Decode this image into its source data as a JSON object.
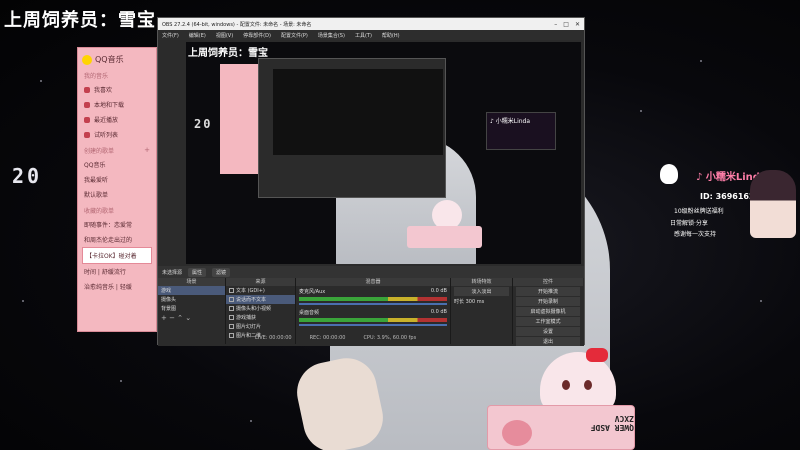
{
  "caption": "上周饲养员：雪宝",
  "big_number": "20",
  "qq_music": {
    "app_name": "QQ音乐",
    "sections": [
      {
        "title": "我的音乐",
        "items": [
          "我喜欢",
          "本地和下载",
          "最近播放",
          "试听列表"
        ]
      },
      {
        "title": "创建的歌单",
        "items": [
          "QQ音乐",
          "我最爱听",
          "默认歌单"
        ]
      },
      {
        "title": "收藏的歌单",
        "items": [
          "即随事件：恋爱常",
          "和周杰伦走出过的",
          "【卡拉OK】碰对着",
          "时间 | 舒缓流行",
          "治愈纯音乐 | 轻缓"
        ]
      }
    ]
  },
  "obs": {
    "title": "OBS 27.2.4 (64-bit, windows) - 配置文件: 未命名 - 场景: 未命名",
    "menu": [
      "文件(F)",
      "编辑(E)",
      "视图(V)",
      "停靠部件(D)",
      "配置文件(P)",
      "场景集合(S)",
      "工具(T)",
      "帮助(H)"
    ],
    "window_buttons": [
      "–",
      "□",
      "✕"
    ],
    "scene_bar": {
      "label": "未选择源",
      "properties": "属性",
      "filters": "滤镜"
    },
    "scenes": {
      "header": "场景",
      "items": [
        "游戏",
        "摄像头",
        "背景图"
      ]
    },
    "sources": {
      "header": "来源",
      "items": [
        "文本 (GDI+)",
        "说话而不文本",
        "摄像头和小视频",
        "游戏捕获",
        "图片幻灯片",
        "图片和二维"
      ]
    },
    "mixer": {
      "header": "混音器",
      "channels": [
        {
          "name": "麦克风/Aux",
          "db": "0.0 dB"
        },
        {
          "name": "桌面音频",
          "db": "0.0 dB"
        }
      ]
    },
    "transitions": {
      "header": "转场特效",
      "type": "淡入淡出",
      "duration_label": "时长",
      "duration": "300 ms"
    },
    "controls": {
      "header": "控件",
      "buttons": [
        "开始推流",
        "开始录制",
        "启动虚拟摄像机",
        "工作室模式",
        "设置",
        "退出"
      ]
    },
    "status": {
      "live": "LIVE: 00:00:00",
      "rec": "REC: 00:00:00",
      "cpu": "CPU: 3.9%, 60.00 fps"
    }
  },
  "badge": {
    "name": "♪ 小糯米Linda",
    "id": "ID: 36961625",
    "line1": "10级粉丝牌送福利",
    "line2": "日常解锁·分享",
    "line3": "感谢每一次支持"
  },
  "keyboard_keys": "QWER ASDF ZXCV"
}
